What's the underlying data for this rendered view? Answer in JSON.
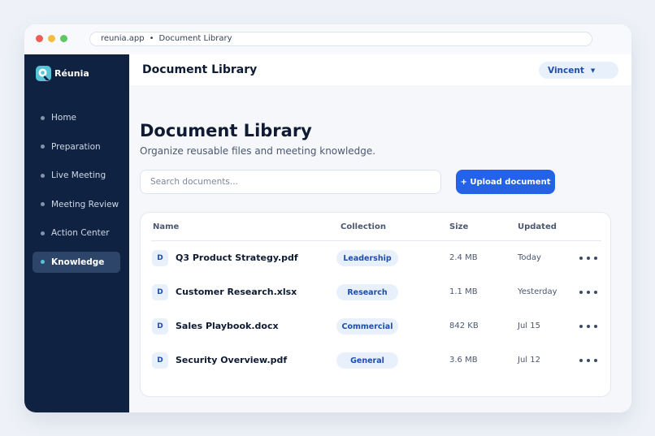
{
  "browser": {
    "address": "reunia.app",
    "address_separator": "•",
    "address_page": "Document Library"
  },
  "sidebar": {
    "brand": "Réunia",
    "items": [
      {
        "label": "Home"
      },
      {
        "label": "Preparation"
      },
      {
        "label": "Live Meeting"
      },
      {
        "label": "Meeting Review"
      },
      {
        "label": "Action Center"
      },
      {
        "label": "Knowledge",
        "active": true
      }
    ]
  },
  "topbar": {
    "title": "Document Library",
    "user": "Vincent",
    "user_caret": "▼"
  },
  "main": {
    "heading": "Document Library",
    "subtitle": "Organize reusable files and meeting knowledge.",
    "search_placeholder": "Search documents...",
    "upload_label": "+ Upload document"
  },
  "table": {
    "columns": [
      "Name",
      "Collection",
      "Size",
      "Updated"
    ],
    "rows": [
      {
        "icon": "D",
        "name": "Q3 Product Strategy.pdf",
        "collection": "Leadership",
        "size": "2.4 MB",
        "updated": "Today"
      },
      {
        "icon": "D",
        "name": "Customer Research.xlsx",
        "collection": "Research",
        "size": "1.1 MB",
        "updated": "Yesterday"
      },
      {
        "icon": "D",
        "name": "Sales Playbook.docx",
        "collection": "Commercial",
        "size": "842 KB",
        "updated": "Jul 15"
      },
      {
        "icon": "D",
        "name": "Security Overview.pdf",
        "collection": "General",
        "size": "3.6 MB",
        "updated": "Jul 12"
      }
    ]
  },
  "colors": {
    "sidebar_bg": "#0f2242",
    "accent": "#2463e8",
    "brand_teal": "#55c4d6",
    "badge_bg": "#e8f0fc",
    "badge_text": "#1e4ea8"
  },
  "icons": [
    "window-close-dot",
    "window-minimize-dot",
    "window-maximize-dot",
    "reunia-logo-icon",
    "nav-bullet-icon",
    "caret-down-icon",
    "file-icon",
    "more-options-icon"
  ]
}
